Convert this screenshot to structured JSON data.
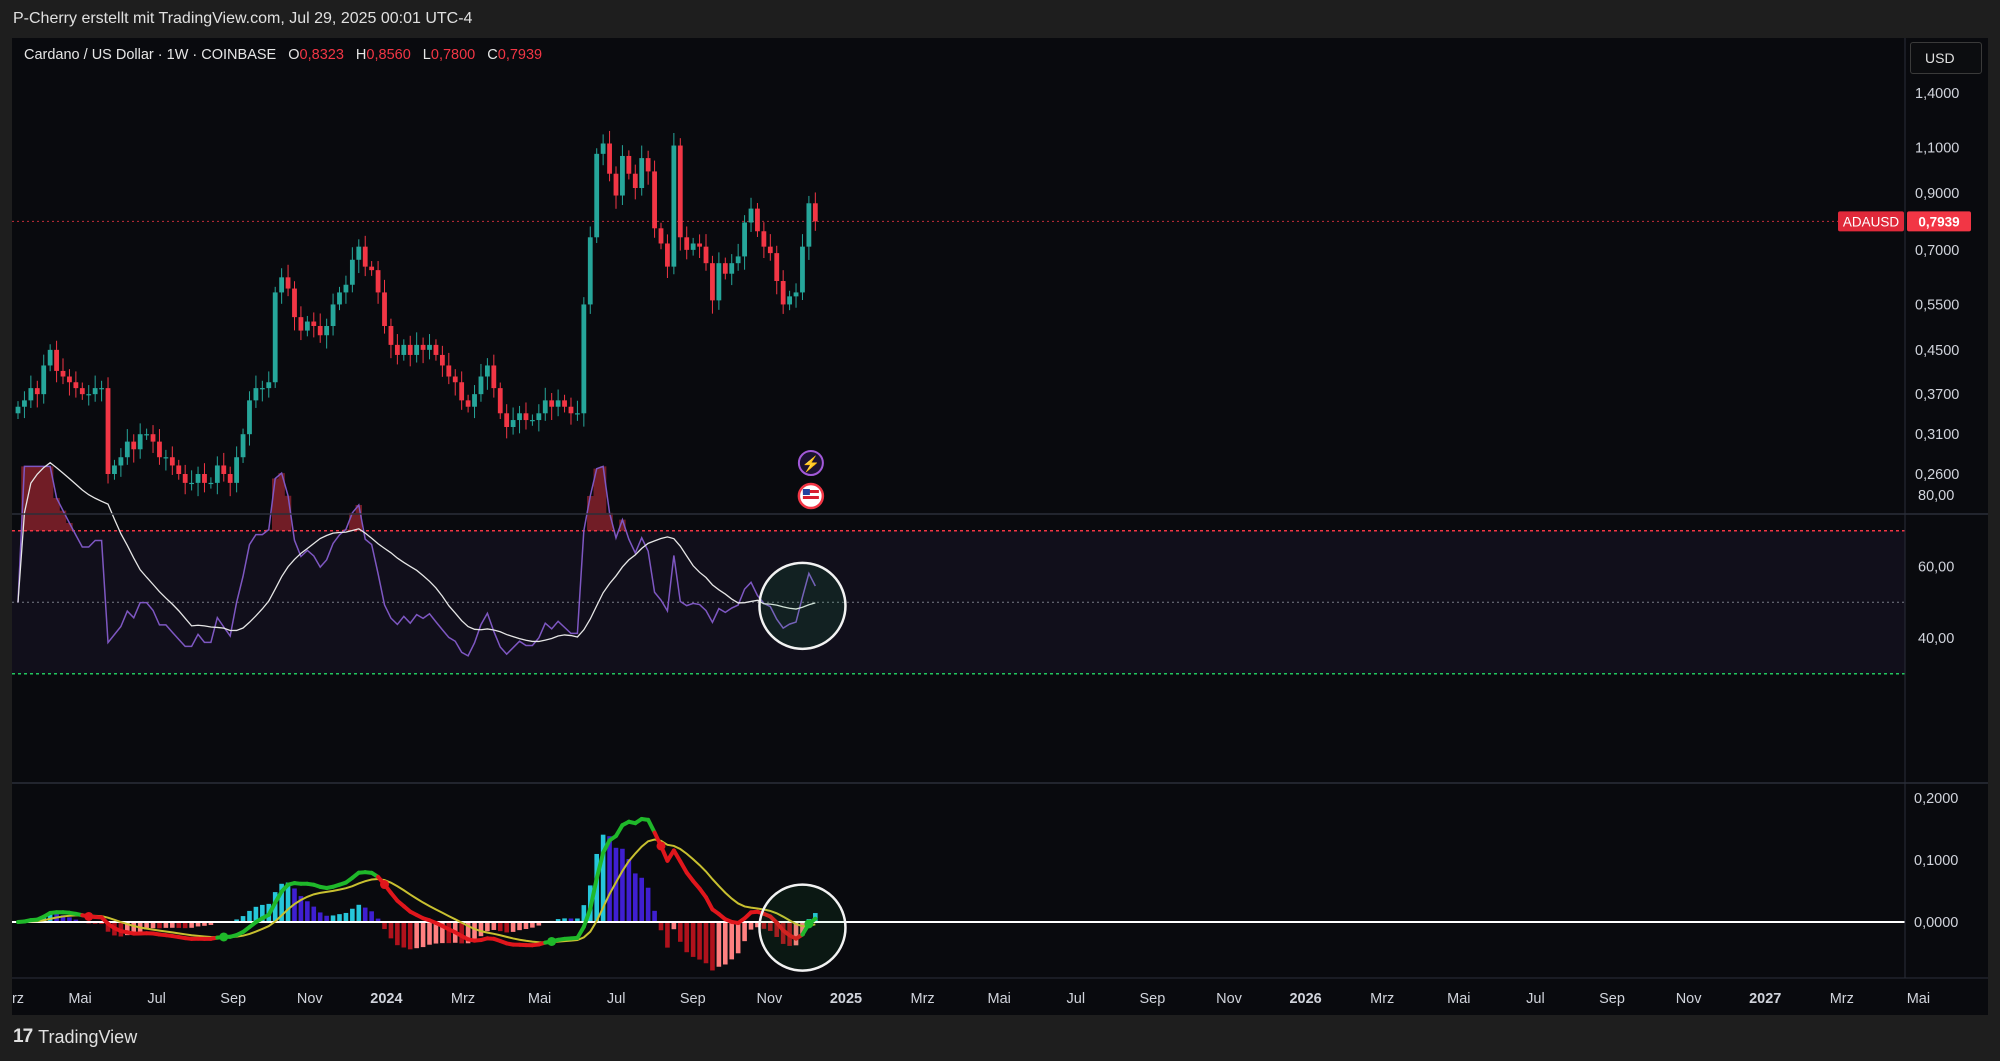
{
  "header": {
    "attribution": "P-Cherry erstellt mit TradingView.com, Jul 29, 2025 00:01 UTC-4"
  },
  "footer": {
    "logo_text": "TradingView",
    "logo_mark": "17"
  },
  "legend": {
    "symbol": "Cardano / US Dollar · 1W · COINBASE",
    "open_label": "O",
    "open": "0,8323",
    "high_label": "H",
    "high": "0,8560",
    "low_label": "L",
    "low": "0,7800",
    "close_label": "C",
    "close": "0,7939"
  },
  "currency": "USD",
  "price_tag": {
    "symbol": "ADAUSD",
    "value": "0,7939"
  },
  "colors": {
    "up": "#26a69a",
    "down": "#f23645",
    "rsi": "#7e57c2",
    "macd_up": "#1fb82a",
    "macd_down": "#e0161c",
    "signal": "#c8c030"
  },
  "chart_data": [
    {
      "type": "candlestick",
      "title": "Cardano / US Dollar · 1W · COINBASE",
      "scale": "log",
      "yticks": [
        0.26,
        0.31,
        0.37,
        0.45,
        0.55,
        0.7,
        0.9,
        1.1,
        1.4
      ],
      "ytick_labels": [
        "0,2600",
        "0,3100",
        "0,3700",
        "0,4500",
        "0,5500",
        "0,7000",
        "0,9000",
        "1,1000",
        "1,4000"
      ],
      "last_price": 0.7939,
      "start_date": "2023-03-05",
      "close": [
        0.35,
        0.36,
        0.38,
        0.37,
        0.42,
        0.45,
        0.41,
        0.4,
        0.39,
        0.38,
        0.37,
        0.37,
        0.38,
        0.38,
        0.26,
        0.27,
        0.28,
        0.3,
        0.29,
        0.31,
        0.31,
        0.3,
        0.28,
        0.28,
        0.27,
        0.26,
        0.25,
        0.25,
        0.26,
        0.25,
        0.25,
        0.27,
        0.26,
        0.25,
        0.28,
        0.31,
        0.36,
        0.38,
        0.38,
        0.39,
        0.58,
        0.62,
        0.59,
        0.52,
        0.49,
        0.51,
        0.5,
        0.48,
        0.5,
        0.55,
        0.58,
        0.6,
        0.67,
        0.71,
        0.65,
        0.64,
        0.58,
        0.5,
        0.46,
        0.44,
        0.46,
        0.44,
        0.46,
        0.45,
        0.46,
        0.44,
        0.42,
        0.4,
        0.39,
        0.36,
        0.35,
        0.37,
        0.4,
        0.42,
        0.38,
        0.34,
        0.32,
        0.33,
        0.34,
        0.33,
        0.33,
        0.34,
        0.36,
        0.35,
        0.36,
        0.35,
        0.34,
        0.34,
        0.55,
        0.74,
        1.07,
        1.12,
        0.98,
        0.89,
        1.06,
        0.98,
        0.92,
        1.05,
        0.99,
        0.77,
        0.72,
        0.65,
        1.11,
        0.74,
        0.7,
        0.72,
        0.71,
        0.66,
        0.56,
        0.66,
        0.63,
        0.66,
        0.68,
        0.79,
        0.84,
        0.76,
        0.71,
        0.69,
        0.61,
        0.55,
        0.57,
        0.58,
        0.71,
        0.86,
        0.7939
      ],
      "ohlc_note": "Weekly closes approximated from the chart; opens equal the previous close"
    },
    {
      "type": "line",
      "name": "RSI",
      "yticks": [
        40,
        60,
        80
      ],
      "ytick_labels": [
        "40,00",
        "60,00",
        "80,00"
      ],
      "levels": [
        30,
        50,
        70
      ],
      "note": "Annotated with a highlight circle at the latest readings"
    },
    {
      "type": "line",
      "name": "MACD",
      "yticks": [
        0,
        0.1,
        0.2
      ],
      "ytick_labels": [
        "0,0000",
        "0,1000",
        "0,2000"
      ],
      "note": "MACD line, signal line and histogram; highlight circle on the latest crossover"
    }
  ],
  "xaxis": {
    "labels": [
      {
        "t": "rz",
        "bold": false
      },
      {
        "t": "Mai",
        "bold": false
      },
      {
        "t": "Jul",
        "bold": false
      },
      {
        "t": "Sep",
        "bold": false
      },
      {
        "t": "Nov",
        "bold": false
      },
      {
        "t": "2024",
        "bold": true
      },
      {
        "t": "Mrz",
        "bold": false
      },
      {
        "t": "Mai",
        "bold": false
      },
      {
        "t": "Jul",
        "bold": false
      },
      {
        "t": "Sep",
        "bold": false
      },
      {
        "t": "Nov",
        "bold": false
      },
      {
        "t": "2025",
        "bold": true
      },
      {
        "t": "Mrz",
        "bold": false
      },
      {
        "t": "Mai",
        "bold": false
      },
      {
        "t": "Jul",
        "bold": false
      },
      {
        "t": "Sep",
        "bold": false
      },
      {
        "t": "Nov",
        "bold": false
      },
      {
        "t": "2026",
        "bold": true
      },
      {
        "t": "Mrz",
        "bold": false
      },
      {
        "t": "Mai",
        "bold": false
      },
      {
        "t": "Jul",
        "bold": false
      },
      {
        "t": "Sep",
        "bold": false
      },
      {
        "t": "Nov",
        "bold": false
      },
      {
        "t": "2027",
        "bold": true
      },
      {
        "t": "Mrz",
        "bold": false
      },
      {
        "t": "Mai",
        "bold": false
      }
    ]
  }
}
